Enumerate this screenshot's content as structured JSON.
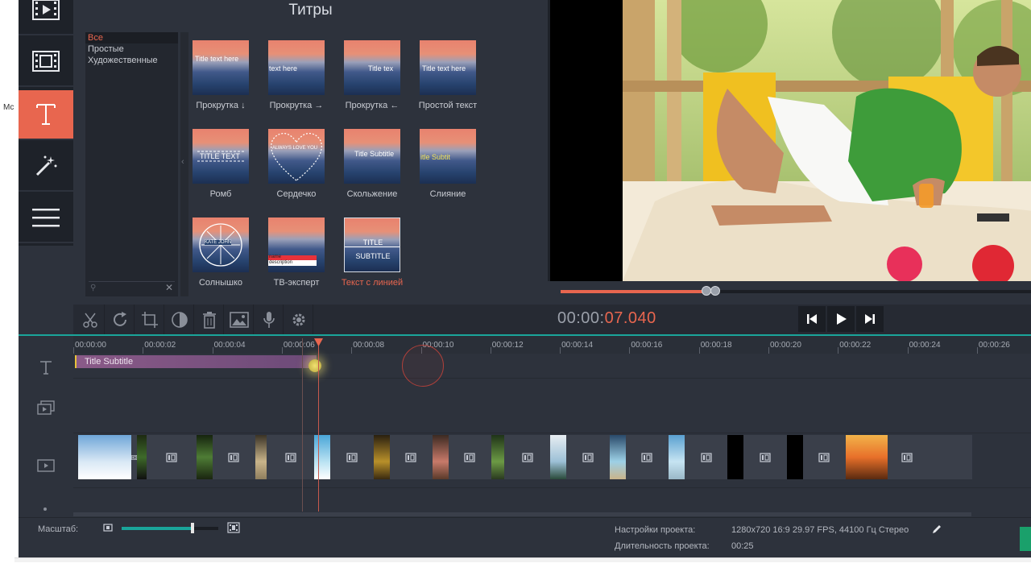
{
  "app": {
    "side_stub_text": "Mc",
    "panel_title": "Титры"
  },
  "colors": {
    "accent": "#e8664f",
    "teal": "#1aa59a",
    "bg": "#2d323c"
  },
  "left_tools": [
    {
      "icon": "film-import-icon",
      "active": false
    },
    {
      "icon": "filters-film-icon",
      "active": false
    },
    {
      "icon": "titles-T-icon",
      "active": true
    },
    {
      "icon": "magic-wand-icon",
      "active": false
    },
    {
      "icon": "menu-hamburger-icon",
      "active": false
    }
  ],
  "categories": [
    {
      "label": "Все",
      "selected": true
    },
    {
      "label": "Простые",
      "selected": false
    },
    {
      "label": "Художественные",
      "selected": false
    }
  ],
  "tiles": [
    {
      "label": "Прокрутка ↓",
      "thumb_text": "Title text here",
      "accent": false
    },
    {
      "label": "Прокрутка →",
      "thumb_text": "text here",
      "accent": false
    },
    {
      "label": "Прокрутка ←",
      "thumb_text": "Title tex",
      "accent": false
    },
    {
      "label": "Простой текст",
      "thumb_text": "Title text here",
      "accent": false
    },
    {
      "label": "Ромб",
      "thumb_text": "TITLE TEXT",
      "accent": false
    },
    {
      "label": "Сердечко",
      "thumb_text": "ALWAYS LOVE YOU",
      "accent": false
    },
    {
      "label": "Скольжение",
      "thumb_text": "Title Subtitle",
      "accent": false
    },
    {
      "label": "Слияние",
      "thumb_text": "itle Subtit",
      "accent": false
    },
    {
      "label": "Солнышко",
      "thumb_text": "KATE JOHN",
      "accent": false
    },
    {
      "label": "ТВ-эксперт",
      "thumb_text": "name description",
      "accent": false
    },
    {
      "label": "Текст с линией",
      "thumb_text": "TITLE SUBTITLE",
      "accent": true
    }
  ],
  "preview": {
    "progress": 0.32,
    "timecode_prefix": "00:00:",
    "timecode_suffix": "07.040"
  },
  "edit_tools": [
    "scissors-icon",
    "rotate-icon",
    "crop-icon",
    "color-adjust-icon",
    "trash-icon",
    "image-icon",
    "microphone-icon",
    "settings-gear-icon"
  ],
  "playback": [
    "previous-icon",
    "play-icon",
    "next-icon"
  ],
  "timeline": {
    "ticks": [
      "00:00:00",
      "00:00:02",
      "00:00:04",
      "00:00:06",
      "00:00:08",
      "00:00:10",
      "00:00:12",
      "00:00:14",
      "00:00:16",
      "00:00:18",
      "00:00:20",
      "00:00:22",
      "00:00:24",
      "00:00:26"
    ],
    "title_clip": "Title Subtitle"
  },
  "bottom": {
    "zoom_label": "Масштаб:",
    "zoom_level": 0.73,
    "settings_label": "Настройки проекта:",
    "settings_value": "1280x720 16:9 29.97 FPS, 44100 Гц Стерео",
    "duration_label": "Длительность проекта:",
    "duration_value": "00:25"
  }
}
